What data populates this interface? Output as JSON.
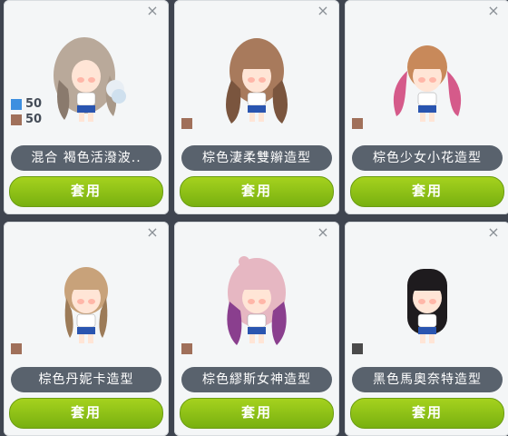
{
  "cards": [
    {
      "name": "混合  褐色活潑波..",
      "apply_label": "套用",
      "close_glyph": "×",
      "swatches": [
        {
          "color": "#3d8fe0",
          "pct": "50"
        },
        {
          "color": "#a0705a",
          "pct": "50"
        }
      ],
      "hair": {
        "main": "#b9a99a",
        "dark": "#8a7a6d",
        "style": "wavy-side"
      }
    },
    {
      "name": "棕色淒柔雙辮造型",
      "apply_label": "套用",
      "close_glyph": "×",
      "swatches": [
        {
          "color": "#a0705a"
        }
      ],
      "hair": {
        "main": "#a87a5c",
        "dark": "#7a553e",
        "style": "long-curls"
      }
    },
    {
      "name": "棕色少女小花造型",
      "apply_label": "套用",
      "close_glyph": "×",
      "swatches": [
        {
          "color": "#a0705a"
        }
      ],
      "hair": {
        "main": "#d55a8a",
        "dark": "#c8895a",
        "style": "twin-tails"
      }
    },
    {
      "name": "棕色丹妮卡造型",
      "apply_label": "套用",
      "close_glyph": "×",
      "swatches": [
        {
          "color": "#a0705a"
        }
      ],
      "hair": {
        "main": "#c8a27a",
        "dark": "#9c7b58",
        "style": "braids"
      }
    },
    {
      "name": "棕色繆斯女神造型",
      "apply_label": "套用",
      "close_glyph": "×",
      "swatches": [
        {
          "color": "#a0705a"
        }
      ],
      "hair": {
        "main": "#e6b7c2",
        "dark": "#8a3f8e",
        "style": "long-curls"
      }
    },
    {
      "name": "黑色馬奧奈特造型",
      "apply_label": "套用",
      "close_glyph": "×",
      "swatches": [
        {
          "color": "#4a4a4a"
        }
      ],
      "hair": {
        "main": "#1e1b1e",
        "dark": "#0d0b0d",
        "style": "straight"
      }
    }
  ]
}
